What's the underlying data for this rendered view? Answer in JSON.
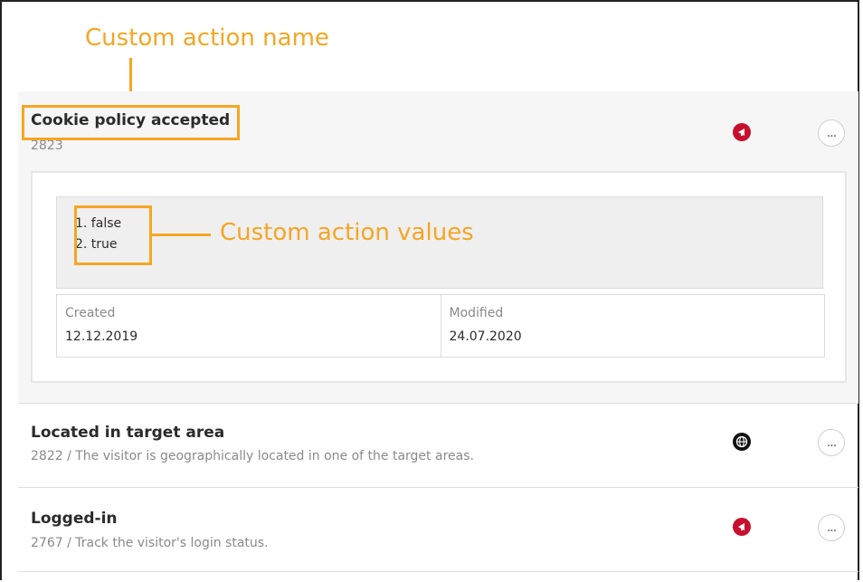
{
  "annotations": {
    "name_label": "Custom action name",
    "values_label": "Custom action values"
  },
  "items": [
    {
      "title": "Cookie policy accepted",
      "subtitle": "2823",
      "icon": "megaphone-icon",
      "icon_color": "#c8102e",
      "values": [
        "1. false",
        "2. true"
      ],
      "created_label": "Created",
      "created_value": "12.12.2019",
      "modified_label": "Modified",
      "modified_value": "24.07.2020",
      "more_label": "..."
    },
    {
      "title": "Located in target area",
      "subtitle": "2822 / The visitor is geographically located in one of the target areas.",
      "icon": "globe-icon",
      "icon_color": "#111111",
      "more_label": "..."
    },
    {
      "title": "Logged-in",
      "subtitle": "2767 / Track the visitor's login status.",
      "icon": "megaphone-icon",
      "icon_color": "#c8102e",
      "more_label": "..."
    }
  ],
  "accent_color": "#f5a623"
}
